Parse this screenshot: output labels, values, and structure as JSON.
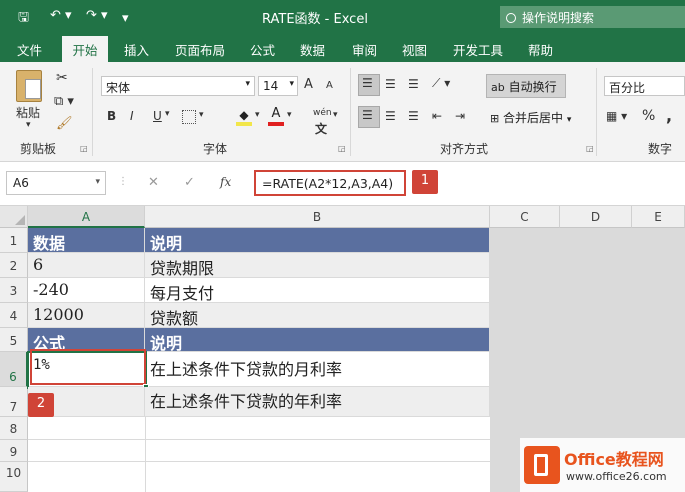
{
  "app": {
    "title": "RATE函数  -  Excel",
    "tell_me": "操作说明搜索"
  },
  "quick_access": {
    "save": "🖫",
    "undo": "↶ ▾",
    "redo": "↷ ▾",
    "more": "▾"
  },
  "tabs": [
    "文件",
    "开始",
    "插入",
    "页面布局",
    "公式",
    "数据",
    "审阅",
    "视图",
    "开发工具",
    "帮助"
  ],
  "ribbon": {
    "clipboard": {
      "paste": "粘贴",
      "group": "剪贴板"
    },
    "font": {
      "name": "宋体",
      "size": "14",
      "bold": "B",
      "italic": "I",
      "underline": "U",
      "grow": "A",
      "shrink": "A",
      "wen": "wén",
      "group": "字体"
    },
    "alignment": {
      "wrap": "自动换行",
      "merge": "合并后居中",
      "group": "对齐方式"
    },
    "number": {
      "format": "百分比",
      "percent": "%",
      "comma": ",",
      "group": "数字"
    }
  },
  "formula_bar": {
    "name_box": "A6",
    "cancel": "✕",
    "enter": "✓",
    "fx": "fx",
    "formula": "=RATE(A2*12,A3,A4)",
    "badge": "1"
  },
  "sheet": {
    "columns": [
      "A",
      "B",
      "C",
      "D",
      "E"
    ],
    "rows": [
      "1",
      "2",
      "3",
      "4",
      "5",
      "6",
      "7",
      "8",
      "9",
      "10"
    ],
    "cells": {
      "A1": "数据",
      "B1": "说明",
      "A2": "6",
      "B2": "贷款期限",
      "A3": "-240",
      "B3": "每月支付",
      "A4": "12000",
      "B4": "贷款额",
      "A5": "公式",
      "B5": "说明",
      "A6": "1%",
      "B6": "在上述条件下贷款的月利率",
      "A7": "",
      "B7": "在上述条件下贷款的年利率"
    },
    "badge": "2"
  },
  "watermark": {
    "brand": "Office教程网",
    "url": "www.office26.com"
  },
  "colors": {
    "excel_green": "#217346",
    "header_fill": "#5a6f9f",
    "highlight_red": "#d04437"
  }
}
